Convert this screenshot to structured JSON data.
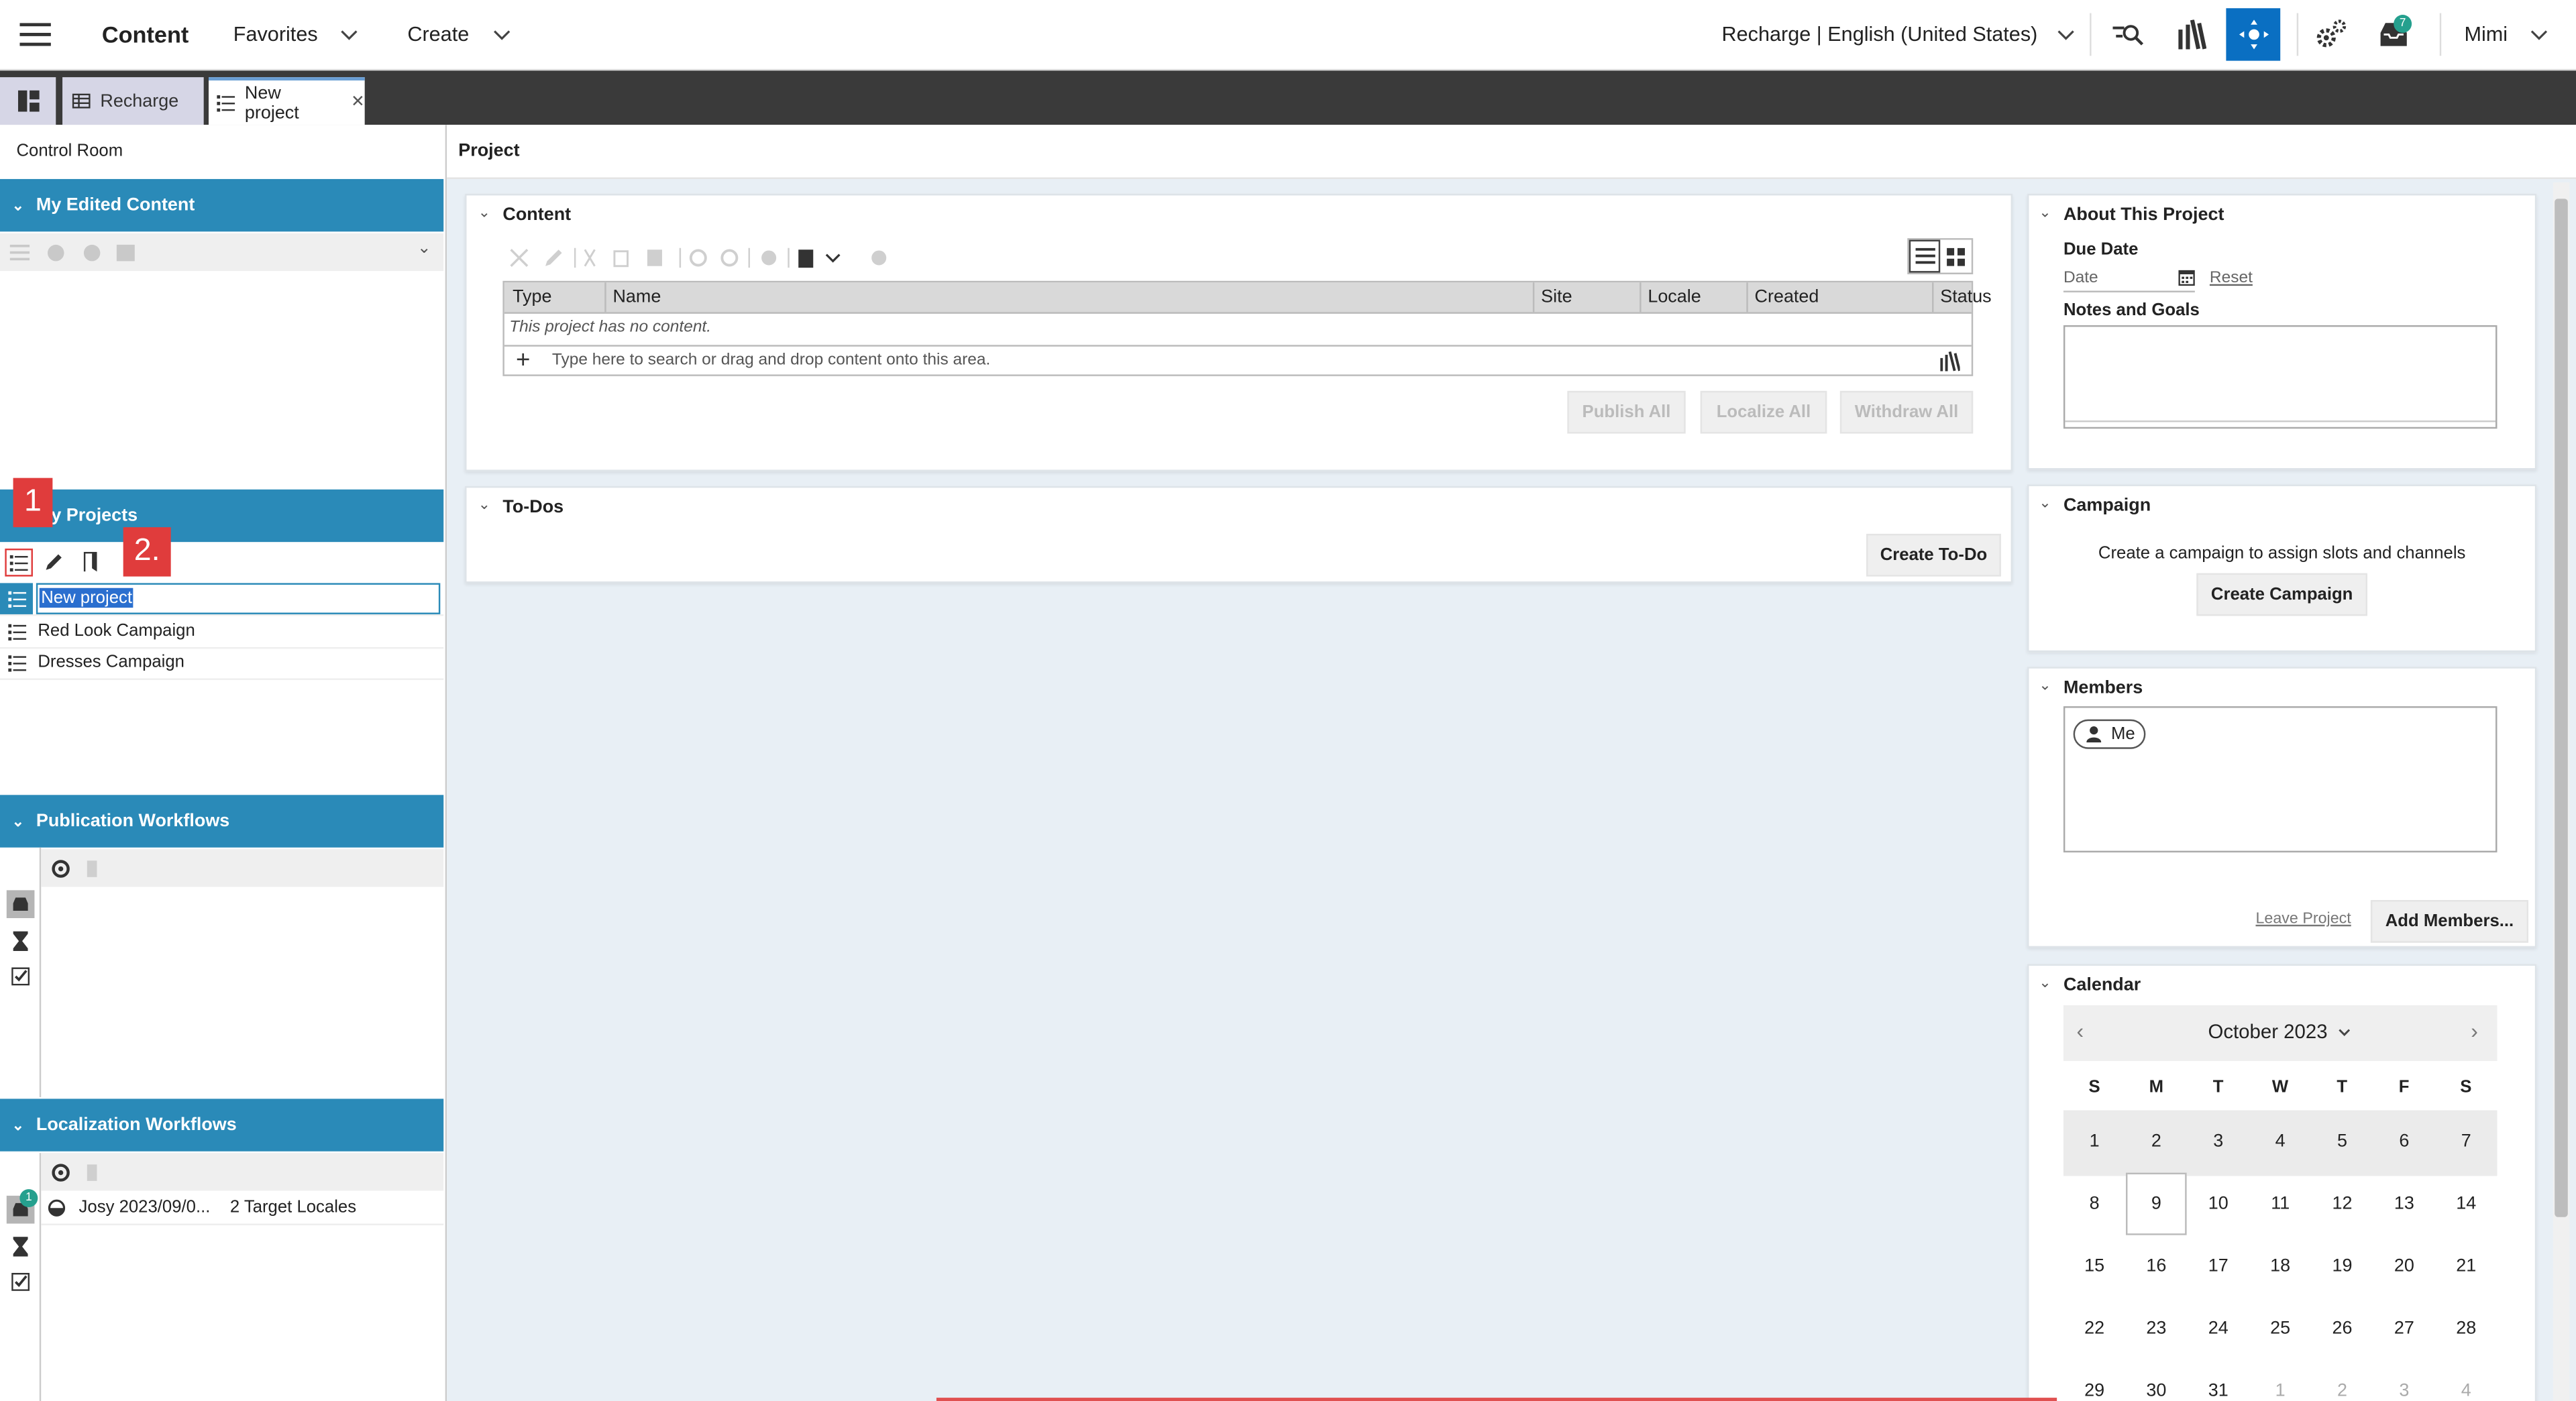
{
  "topbar": {
    "app_title": "Content",
    "favorites": "Favorites",
    "create": "Create",
    "site_locale": "Recharge | English (United States)",
    "notification_count": "7",
    "user": "Mimi"
  },
  "tabs": [
    {
      "label": "Recharge"
    },
    {
      "label": "New project"
    }
  ],
  "left": {
    "title": "Control Room",
    "my_edited_content": "My Edited Content",
    "my_projects": "My Projects",
    "projects": [
      {
        "label": "New project"
      },
      {
        "label": "Red Look Campaign"
      },
      {
        "label": "Dresses Campaign"
      }
    ],
    "publication_workflows": "Publication Workflows",
    "localization_workflows": "Localization Workflows",
    "localization_item": {
      "name": "Josy 2023/09/0...",
      "targets": "2 Target Locales",
      "badge": "1"
    }
  },
  "annotations": {
    "marker1": "1",
    "marker2": "2."
  },
  "main": {
    "title": "Project",
    "content": {
      "title": "Content",
      "columns": [
        "Type",
        "Name",
        "Site",
        "Locale",
        "Created",
        "Status"
      ],
      "empty_text": "This project has no content.",
      "search_placeholder": "Type here to search or drag and drop content onto this area.",
      "publish_all": "Publish All",
      "localize_all": "Localize All",
      "withdraw_all": "Withdraw All"
    },
    "todos": {
      "title": "To-Dos",
      "create_button": "Create To-Do"
    }
  },
  "right": {
    "about": {
      "title": "About This Project",
      "due_date_label": "Due Date",
      "date_placeholder": "Date",
      "reset": "Reset",
      "notes_label": "Notes and Goals"
    },
    "campaign": {
      "title": "Campaign",
      "text": "Create a campaign to assign slots and channels",
      "button": "Create Campaign"
    },
    "members": {
      "title": "Members",
      "me": "Me",
      "leave": "Leave Project",
      "add": "Add Members..."
    },
    "calendar": {
      "title": "Calendar",
      "month": "October 2023",
      "weekdays": [
        "S",
        "M",
        "T",
        "W",
        "T",
        "F",
        "S"
      ],
      "weeks": [
        [
          "1",
          "2",
          "3",
          "4",
          "5",
          "6",
          "7"
        ],
        [
          "8",
          "9",
          "10",
          "11",
          "12",
          "13",
          "14"
        ],
        [
          "15",
          "16",
          "17",
          "18",
          "19",
          "20",
          "21"
        ],
        [
          "22",
          "23",
          "24",
          "25",
          "26",
          "27",
          "28"
        ],
        [
          "29",
          "30",
          "31",
          "1",
          "2",
          "3",
          "4"
        ]
      ],
      "today": "9"
    }
  },
  "colors": {
    "accent_blue": "#2a8ab8",
    "active_button": "#0a6fc2",
    "annotation_red": "#e03c3c",
    "badge_green": "#25a08e"
  }
}
